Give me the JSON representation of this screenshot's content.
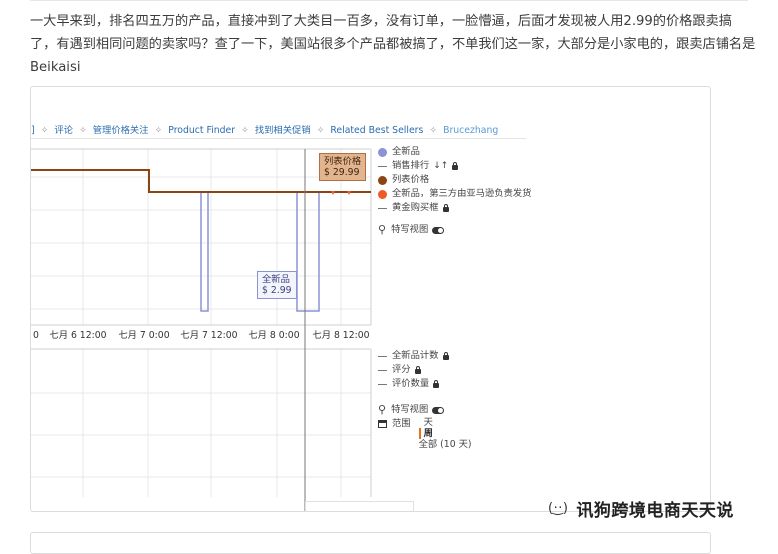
{
  "post": {
    "paragraph": "一大早来到，排名四五万的产品，直接冲到了大类目一百多，没有订单，一脸懵逼，后面才发现被人用2.99的价格跟卖搞了，有遇到相同问题的卖家吗？查了一下，美国站很多个产品都被搞了，不单我们这一家，大部分是小家电的，跟卖店铺名是Beikaisi"
  },
  "nav": {
    "items": [
      "]",
      "评论",
      "管理价格关注",
      "Product Finder",
      "找到相关促销",
      "Related Best Sellers",
      "Brucezhang"
    ],
    "separator": "✧"
  },
  "price_chart": {
    "x_ticks": [
      "0",
      "七月 6 12:00",
      "七月 7 0:00",
      "七月 7 12:00",
      "七月 8 0:00",
      "七月 8 12:00"
    ],
    "tooltip_list": {
      "label": "列表价格",
      "value": "$ 29.99"
    },
    "tooltip_new": {
      "label": "全新品",
      "value": "$ 2.99"
    }
  },
  "legend_top": {
    "items": [
      {
        "label": "全新品",
        "marker": "dot",
        "color": "#8b93d6",
        "lock": false,
        "sort": false
      },
      {
        "label": "销售排行",
        "marker": "dash",
        "color": "#777777",
        "lock": true,
        "sort": true
      },
      {
        "label": "列表价格",
        "marker": "dot",
        "color": "#8b4513",
        "lock": false,
        "sort": false
      },
      {
        "label": "全新品，第三方由亚马逊负责发货",
        "marker": "dot",
        "color": "#f05a28",
        "lock": false,
        "sort": false
      },
      {
        "label": "黄金购买框",
        "marker": "dash",
        "color": "#777777",
        "lock": true,
        "sort": false
      }
    ],
    "special_view": "特写视图"
  },
  "legend_bottom": {
    "items": [
      {
        "label": "全新品计数",
        "lock": true
      },
      {
        "label": "评分",
        "lock": true
      },
      {
        "label": "评价数量",
        "lock": true
      }
    ],
    "special_view": "特写视图",
    "range_label": "范围",
    "range_options": [
      "天",
      "周",
      "全部 (10 天)"
    ]
  },
  "watermark": {
    "text": "讯狗跨境电商天天说",
    "icon": "wechat-icon"
  },
  "colors": {
    "list_price": "#8b4513",
    "new_price": "#8b93d6",
    "amazon_fba": "#f05a28",
    "link": "#2b6cb0"
  }
}
